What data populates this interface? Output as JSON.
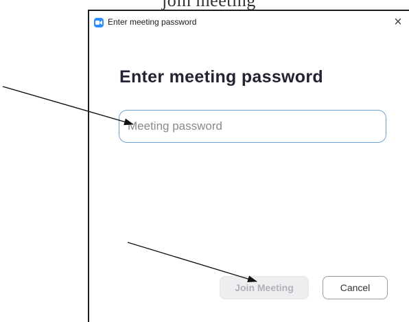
{
  "top_fragment": "join meeting",
  "window": {
    "title": "Enter meeting password",
    "close_glyph": "×",
    "app_icon": "zoom-camera-icon"
  },
  "heading": "Enter meeting password",
  "password_field": {
    "value": "",
    "placeholder": "Meeting password"
  },
  "buttons": {
    "join_label": "Join Meeting",
    "cancel_label": "Cancel"
  },
  "colors": {
    "accent": "#2d8cff",
    "input_border": "#6ea0d8",
    "join_disabled_bg": "#eeeef1",
    "join_disabled_text": "#b0b0b8"
  }
}
